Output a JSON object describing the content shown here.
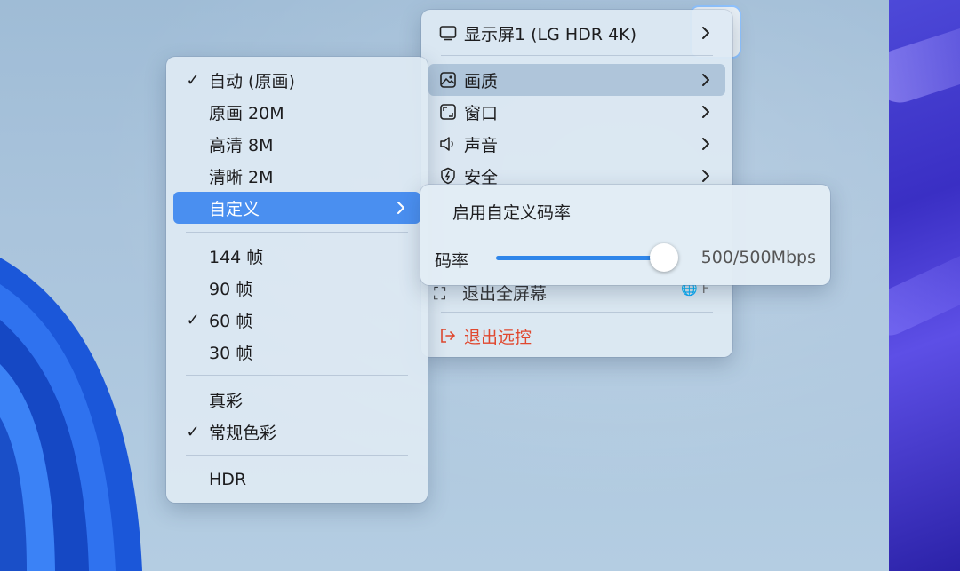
{
  "colors": {
    "accent": "#4a8ff0",
    "slider": "#2f86ea",
    "danger": "#e0482f"
  },
  "main_menu": {
    "items": [
      {
        "label": "显示屏1 (LG HDR 4K)",
        "icon": "monitor-icon"
      },
      {
        "label": "画质",
        "icon": "image-icon"
      },
      {
        "label": "窗口",
        "icon": "window-icon"
      },
      {
        "label": "声音",
        "icon": "speaker-icon"
      },
      {
        "label": "安全",
        "icon": "shield-icon"
      }
    ],
    "partial_item": {
      "label": "退出全屏幕",
      "shortcut": "🌐 F"
    },
    "exit_label": "退出远控",
    "exit_icon": "exit-icon"
  },
  "quality_menu": {
    "resolution_items": [
      {
        "label": "自动 (原画)",
        "checked": true
      },
      {
        "label": "原画 20M",
        "checked": false
      },
      {
        "label": "高清 8M",
        "checked": false
      },
      {
        "label": "清晰 2M",
        "checked": false
      },
      {
        "label": "自定义",
        "checked": false,
        "submenu": true
      }
    ],
    "fps_items": [
      {
        "label": "144 帧",
        "checked": false
      },
      {
        "label": "90 帧",
        "checked": false
      },
      {
        "label": "60 帧",
        "checked": true
      },
      {
        "label": "30 帧",
        "checked": false
      }
    ],
    "color_items": [
      {
        "label": "真彩",
        "checked": false
      },
      {
        "label": "常规色彩",
        "checked": true
      }
    ],
    "hdr_label": "HDR"
  },
  "custom_popover": {
    "enable_label": "启用自定义码率",
    "bitrate_label": "码率",
    "bitrate_value": "500/500Mbps",
    "slider_fraction": 1.0
  }
}
